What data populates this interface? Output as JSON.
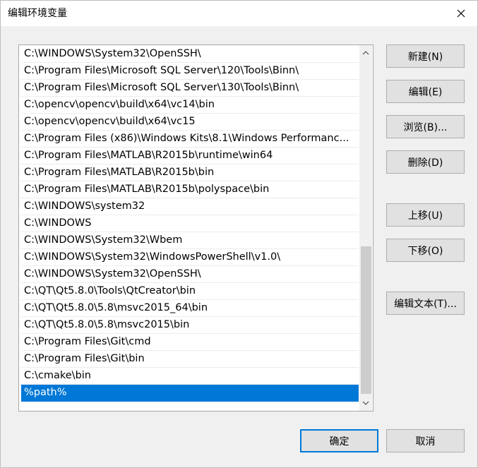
{
  "window": {
    "title": "编辑环境变量",
    "close_icon": "close-icon"
  },
  "paths": [
    "C:\\WINDOWS\\System32\\OpenSSH\\",
    "C:\\Program Files\\Microsoft SQL Server\\120\\Tools\\Binn\\",
    "C:\\Program Files\\Microsoft SQL Server\\130\\Tools\\Binn\\",
    "C:\\opencv\\opencv\\build\\x64\\vc14\\bin",
    "C:\\opencv\\opencv\\build\\x64\\vc15",
    "C:\\Program Files (x86)\\Windows Kits\\8.1\\Windows Performanc...",
    "C:\\Program Files\\MATLAB\\R2015b\\runtime\\win64",
    "C:\\Program Files\\MATLAB\\R2015b\\bin",
    "C:\\Program Files\\MATLAB\\R2015b\\polyspace\\bin",
    "C:\\WINDOWS\\system32",
    "C:\\WINDOWS",
    "C:\\WINDOWS\\System32\\Wbem",
    "C:\\WINDOWS\\System32\\WindowsPowerShell\\v1.0\\",
    "C:\\WINDOWS\\System32\\OpenSSH\\",
    "C:\\QT\\Qt5.8.0\\Tools\\QtCreator\\bin",
    "C:\\QT\\Qt5.8.0\\5.8\\msvc2015_64\\bin",
    "C:\\QT\\Qt5.8.0\\5.8\\msvc2015\\bin",
    "C:\\Program Files\\Git\\cmd",
    "C:\\Program Files\\Git\\bin",
    "C:\\cmake\\bin",
    "%path%"
  ],
  "selected_index": 20,
  "buttons": {
    "new": "新建(N)",
    "edit": "编辑(E)",
    "browse": "浏览(B)...",
    "delete": "删除(D)",
    "move_up": "上移(U)",
    "move_down": "下移(O)",
    "edit_text": "编辑文本(T)...",
    "ok": "确定",
    "cancel": "取消"
  },
  "scrollbar": {
    "up_icon": "scroll-up-arrow-icon",
    "down_icon": "scroll-down-arrow-icon"
  },
  "colors": {
    "selection": "#0078d7",
    "dialog_bg": "#f0f0f0",
    "button_bg": "#e1e1e1"
  }
}
